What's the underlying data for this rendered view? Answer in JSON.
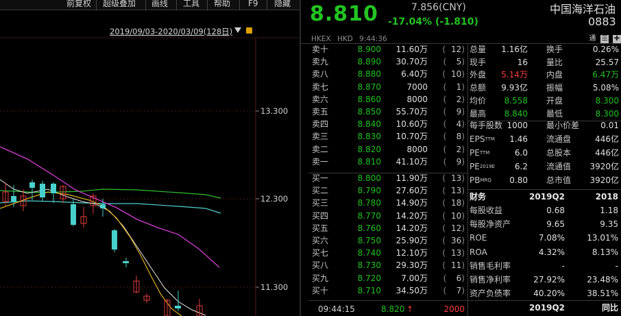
{
  "toolbar": {
    "items": [
      "前复权",
      "超级叠加",
      "画线",
      "工具",
      "帮助",
      "F9",
      "隐藏"
    ]
  },
  "chart": {
    "range_label": "2019/09/03-2020/03/09(128日)",
    "y_ticks": [
      "13.300",
      "12.300",
      "11.300"
    ]
  },
  "quote": {
    "price": "8.810",
    "ref_price": "7.856(CNY)",
    "change": "-17.04% (-1.810)",
    "name": "中国海洋石油",
    "code": "0883",
    "exchange": "HKEX",
    "currency": "HKD",
    "time": "9:44:36",
    "tags": [
      "通",
      "☰",
      "✚"
    ]
  },
  "order_book": {
    "asks": [
      {
        "label": "卖十",
        "price": "8.900",
        "volume": "11.60万",
        "count": "12"
      },
      {
        "label": "卖九",
        "price": "8.890",
        "volume": "30.70万",
        "count": "5"
      },
      {
        "label": "卖八",
        "price": "8.880",
        "volume": "6.40万",
        "count": "10"
      },
      {
        "label": "卖七",
        "price": "8.870",
        "volume": "7000",
        "count": "1"
      },
      {
        "label": "卖六",
        "price": "8.860",
        "volume": "8000",
        "count": "2"
      },
      {
        "label": "卖五",
        "price": "8.850",
        "volume": "55.70万",
        "count": "9"
      },
      {
        "label": "卖四",
        "price": "8.840",
        "volume": "10.60万",
        "count": "4"
      },
      {
        "label": "卖三",
        "price": "8.830",
        "volume": "10.70万",
        "count": "8"
      },
      {
        "label": "卖二",
        "price": "8.820",
        "volume": "8000",
        "count": "2"
      },
      {
        "label": "卖一",
        "price": "8.810",
        "volume": "41.10万",
        "count": "9"
      }
    ],
    "bids": [
      {
        "label": "买一",
        "price": "8.800",
        "volume": "11.90万",
        "count": "13"
      },
      {
        "label": "买二",
        "price": "8.790",
        "volume": "27.60万",
        "count": "13"
      },
      {
        "label": "买三",
        "price": "8.780",
        "volume": "14.90万",
        "count": "18"
      },
      {
        "label": "买四",
        "price": "8.770",
        "volume": "14.20万",
        "count": "10"
      },
      {
        "label": "买五",
        "price": "8.760",
        "volume": "14.20万",
        "count": "12"
      },
      {
        "label": "买六",
        "price": "8.750",
        "volume": "25.90万",
        "count": "36"
      },
      {
        "label": "买七",
        "price": "8.740",
        "volume": "12.10万",
        "count": "13"
      },
      {
        "label": "买八",
        "price": "8.730",
        "volume": "29.30万",
        "count": "11"
      },
      {
        "label": "买九",
        "price": "8.720",
        "volume": "7.00万",
        "count": "6"
      },
      {
        "label": "买十",
        "price": "8.710",
        "volume": "34.50万",
        "count": "7"
      }
    ]
  },
  "stats": [
    {
      "k1": "总量",
      "v1": "1.16亿",
      "c1": "#e0e0e0",
      "k2": "换手",
      "v2": "0.26%",
      "c2": "#e0e0e0"
    },
    {
      "k1": "现手",
      "v1": "16",
      "c1": "#e0e0e0",
      "k2": "量比",
      "v2": "25.57",
      "c2": "#e0e0e0"
    },
    {
      "k1": "外盘",
      "v1": "5.14万",
      "c1": "#ff3b3b",
      "k2": "内盘",
      "v2": "6.47万",
      "c2": "#22c322"
    },
    {
      "k1": "总额",
      "v1": "9.93亿",
      "c1": "#e0e0e0",
      "k2": "振幅",
      "v2": "5.08%",
      "c2": "#e0e0e0"
    },
    {
      "k1": "均价",
      "v1": "8.558",
      "c1": "#22c322",
      "k2": "开盘",
      "v2": "8.300",
      "c2": "#22c322"
    },
    {
      "k1": "最高",
      "v1": "8.840",
      "c1": "#22c322",
      "k2": "最低",
      "v2": "8.300",
      "c2": "#22c322"
    }
  ],
  "stats2": [
    {
      "k1": "每手股数",
      "v1": "1000",
      "k2": "最小价差",
      "v2": "0.01"
    },
    {
      "k1": "EPS",
      "k1sup": "TTM",
      "v1": "1.46",
      "k2": "流通盘",
      "v2": "446亿"
    },
    {
      "k1": "PE",
      "k1sup": "TTM",
      "v1": "6.0",
      "k2": "总股本",
      "v2": "446亿"
    },
    {
      "k1": "PE",
      "k1sup": "2019E",
      "v1": "6.2",
      "k2": "流通值",
      "v2": "3920亿"
    },
    {
      "k1": "PB",
      "k1sup": "MRQ",
      "v1": "0.80",
      "k2": "总市值",
      "v2": "3920亿"
    }
  ],
  "financials": {
    "header": {
      "k": "财务",
      "a": "2019Q2",
      "b": "2018"
    },
    "rows": [
      {
        "k": "每股收益",
        "a": "0.68",
        "b": "1.18"
      },
      {
        "k": "每股净资产",
        "a": "9.65",
        "b": "9.35"
      },
      {
        "k": "ROE",
        "a": "7.08%",
        "b": "13.01%"
      },
      {
        "k": "ROA",
        "a": "4.32%",
        "b": "8.13%"
      },
      {
        "k": "销售毛利率",
        "a": "-",
        "b": "-"
      },
      {
        "k": "销售净利率",
        "a": "27.92%",
        "b": "23.48%"
      },
      {
        "k": "资产负债率",
        "a": "40.20%",
        "b": "38.51%"
      }
    ],
    "footer": {
      "a": "2019Q2",
      "b": "同比"
    }
  },
  "last_trade": {
    "time": "09:44:15",
    "price": "8.820",
    "arrow": "↑",
    "volume": "2000"
  }
}
